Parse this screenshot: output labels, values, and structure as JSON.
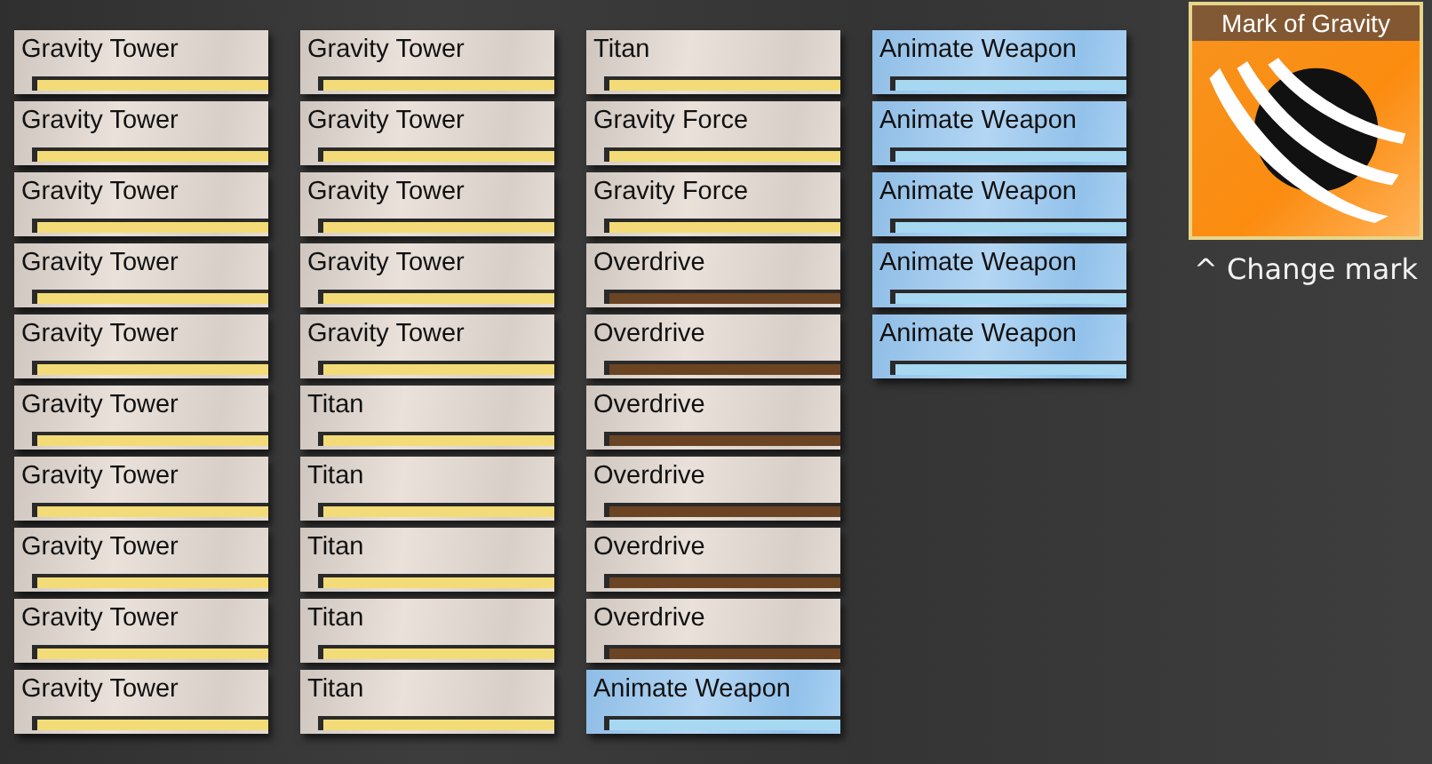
{
  "columns": [
    {
      "cards": [
        {
          "name": "Gravity Tower",
          "kind": "plain",
          "color": "#f3dc78"
        },
        {
          "name": "Gravity Tower",
          "kind": "plain",
          "color": "#f3dc78"
        },
        {
          "name": "Gravity Tower",
          "kind": "plain",
          "color": "#f3dc78"
        },
        {
          "name": "Gravity Tower",
          "kind": "plain",
          "color": "#f3dc78"
        },
        {
          "name": "Gravity Tower",
          "kind": "plain",
          "color": "#f3dc78"
        },
        {
          "name": "Gravity Tower",
          "kind": "plain",
          "color": "#f3dc78"
        },
        {
          "name": "Gravity Tower",
          "kind": "plain",
          "color": "#f3dc78"
        },
        {
          "name": "Gravity Tower",
          "kind": "plain",
          "color": "#f3dc78"
        },
        {
          "name": "Gravity Tower",
          "kind": "plain",
          "color": "#f3dc78"
        },
        {
          "name": "Gravity Tower",
          "kind": "plain",
          "color": "#f3dc78"
        }
      ]
    },
    {
      "cards": [
        {
          "name": "Gravity Tower",
          "kind": "plain",
          "color": "#f3dc78"
        },
        {
          "name": "Gravity Tower",
          "kind": "plain",
          "color": "#f3dc78"
        },
        {
          "name": "Gravity Tower",
          "kind": "plain",
          "color": "#f3dc78"
        },
        {
          "name": "Gravity Tower",
          "kind": "plain",
          "color": "#f3dc78"
        },
        {
          "name": "Gravity Tower",
          "kind": "plain",
          "color": "#f3dc78"
        },
        {
          "name": "Titan",
          "kind": "plain",
          "color": "#f3dc78"
        },
        {
          "name": "Titan",
          "kind": "plain",
          "color": "#f3dc78"
        },
        {
          "name": "Titan",
          "kind": "plain",
          "color": "#f3dc78"
        },
        {
          "name": "Titan",
          "kind": "plain",
          "color": "#f3dc78"
        },
        {
          "name": "Titan",
          "kind": "plain",
          "color": "#f3dc78"
        }
      ]
    },
    {
      "cards": [
        {
          "name": "Titan",
          "kind": "plain",
          "color": "#f3dc78"
        },
        {
          "name": "Gravity Force",
          "kind": "plain",
          "color": "#f3dc78"
        },
        {
          "name": "Gravity Force",
          "kind": "plain",
          "color": "#f3dc78"
        },
        {
          "name": "Overdrive",
          "kind": "plain",
          "color": "#6b4424"
        },
        {
          "name": "Overdrive",
          "kind": "plain",
          "color": "#6b4424"
        },
        {
          "name": "Overdrive",
          "kind": "plain",
          "color": "#6b4424"
        },
        {
          "name": "Overdrive",
          "kind": "plain",
          "color": "#6b4424"
        },
        {
          "name": "Overdrive",
          "kind": "plain",
          "color": "#6b4424"
        },
        {
          "name": "Overdrive",
          "kind": "plain",
          "color": "#6b4424"
        },
        {
          "name": "Animate Weapon",
          "kind": "blue",
          "color": "#a6d8f2"
        }
      ]
    },
    {
      "cards": [
        {
          "name": "Animate Weapon",
          "kind": "blue",
          "color": "#a6d8f2"
        },
        {
          "name": "Animate Weapon",
          "kind": "blue",
          "color": "#a6d8f2"
        },
        {
          "name": "Animate Weapon",
          "kind": "blue",
          "color": "#a6d8f2"
        },
        {
          "name": "Animate Weapon",
          "kind": "blue",
          "color": "#a6d8f2"
        },
        {
          "name": "Animate Weapon",
          "kind": "blue",
          "color": "#a6d8f2"
        }
      ]
    }
  ],
  "mark": {
    "title": "Mark of Gravity",
    "action": "^ Change mark"
  }
}
